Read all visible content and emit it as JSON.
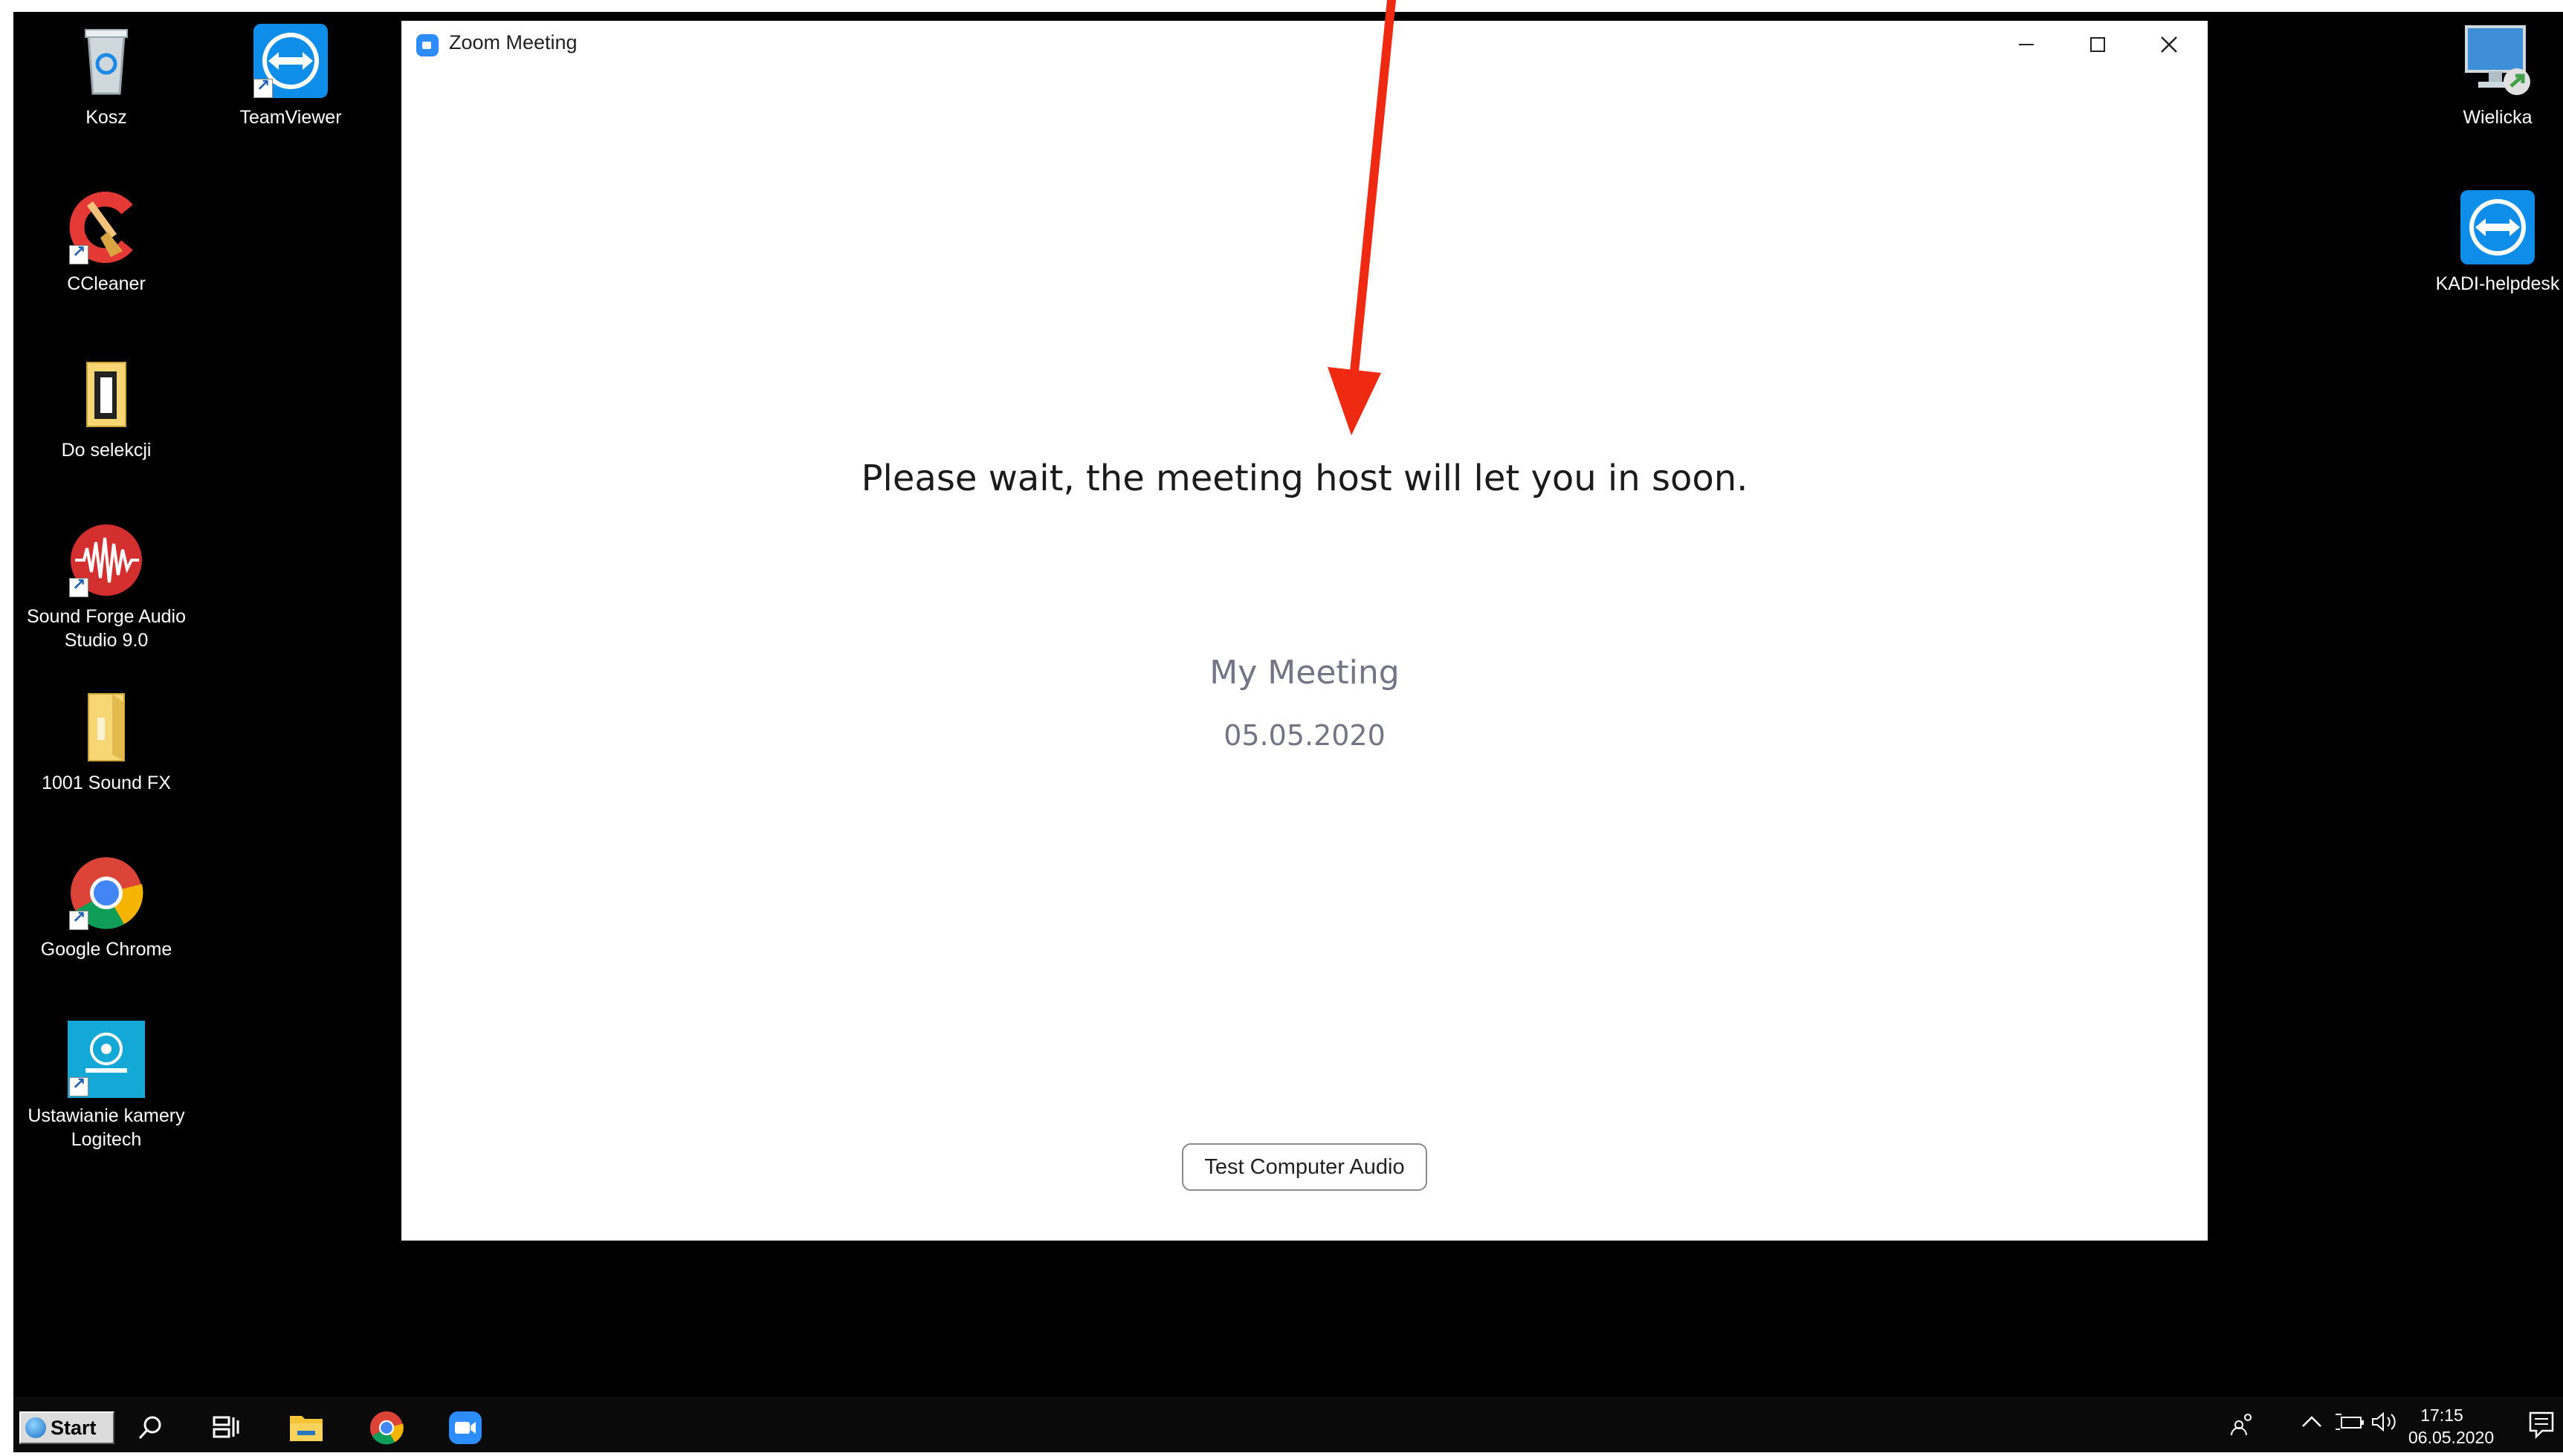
{
  "desktop": {
    "icons_left": [
      {
        "label": "Kosz",
        "icon": "recycle-bin-icon"
      },
      {
        "label": "TeamViewer",
        "icon": "teamviewer-icon"
      },
      {
        "label": "CCleaner",
        "icon": "ccleaner-icon"
      },
      {
        "label": "Do selekcji",
        "icon": "folder-icon"
      },
      {
        "label": "Sound Forge Audio Studio 9.0",
        "icon": "sound-forge-icon"
      },
      {
        "label": "1001 Sound FX",
        "icon": "folder-icon"
      },
      {
        "label": "Google Chrome",
        "icon": "chrome-icon"
      },
      {
        "label": "Ustawianie kamery Logitech",
        "icon": "logitech-camera-icon"
      }
    ],
    "icons_right": [
      {
        "label": "Wielicka",
        "icon": "remote-desktop-icon"
      },
      {
        "label": "KADI-helpdesk",
        "icon": "teamviewer-icon"
      }
    ]
  },
  "zoom_window": {
    "title": "Zoom Meeting",
    "wait_message": "Please wait, the meeting host will let you in soon.",
    "meeting_name": "My Meeting",
    "meeting_date": "05.05.2020",
    "test_audio_button": "Test Computer Audio"
  },
  "taskbar": {
    "start_label": "Start",
    "clock_time": "17:15",
    "clock_date": "06.05.2020"
  },
  "colors": {
    "annotation_arrow": "#ee2a12",
    "zoom_blue": "#2d8cff",
    "meeting_text": "#747487"
  }
}
